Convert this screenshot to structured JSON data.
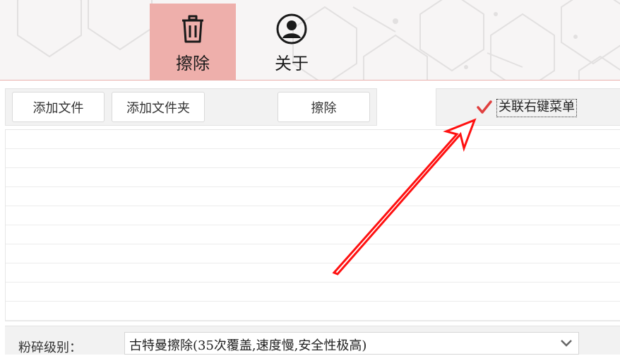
{
  "nav": {
    "tabs": [
      {
        "label": "擦除",
        "icon": "trash-icon",
        "active": true
      },
      {
        "label": "关于",
        "icon": "user-icon",
        "active": false
      }
    ]
  },
  "toolbar": {
    "add_file_label": "添加文件",
    "add_folder_label": "添加文件夹",
    "erase_label": "擦除"
  },
  "options": {
    "context_menu_label": "关联右键菜单",
    "context_menu_checked": true
  },
  "file_list": {
    "rows": []
  },
  "level": {
    "label": "粉碎级别：",
    "selected": "古特曼擦除(35次覆盖,速度慢,安全性极高)"
  },
  "colors": {
    "accent": "#eeafab",
    "check": "#e0403f",
    "arrow": "#ff1010"
  }
}
